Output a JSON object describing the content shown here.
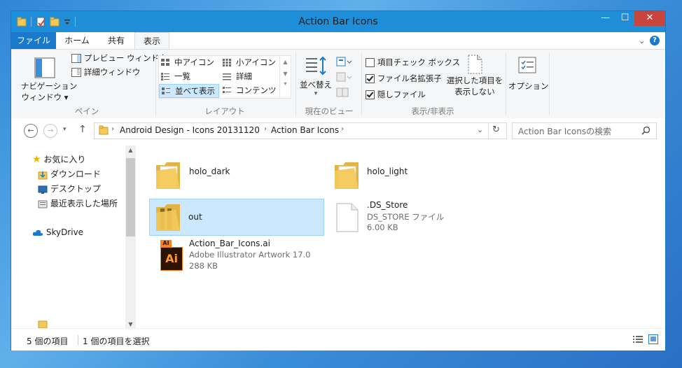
{
  "window": {
    "title": "Action Bar Icons",
    "minimize": "—",
    "maximize": "☐",
    "close": "✕"
  },
  "tabs": {
    "file": "ファイル",
    "home": "ホーム",
    "share": "共有",
    "view": "表示"
  },
  "ribbon": {
    "panes": {
      "nav_pane_line1": "ナビゲーション",
      "nav_pane_line2": "ウィンドウ",
      "preview_pane": "プレビュー ウィンドウ",
      "details_pane": "詳細ウィンドウ",
      "group_label": "ペイン"
    },
    "layout": {
      "medium_icons": "中アイコン",
      "small_icons": "小アイコン",
      "list": "一覧",
      "details": "詳細",
      "tiles": "並べて表示",
      "content": "コンテンツ",
      "group_label": "レイアウト"
    },
    "current_view": {
      "sort_by": "並べ替え",
      "group_label": "現在のビュー"
    },
    "show_hide": {
      "item_check_boxes": "項目チェック ボックス",
      "file_extensions": "ファイル名拡張子",
      "hidden_items": "隠しファイル",
      "item_check_boxes_checked": false,
      "file_extensions_checked": true,
      "hidden_items_checked": true,
      "hide_selected_line1": "選択した項目を",
      "hide_selected_line2": "表示しない",
      "group_label": "表示/非表示"
    },
    "options": "オプション"
  },
  "address": {
    "crumbs": [
      "Android Design - Icons 20131120",
      "Action Bar Icons"
    ],
    "search_placeholder": "Action Bar Iconsの検索"
  },
  "navpane": {
    "favorites": "お気に入り",
    "downloads": "ダウンロード",
    "desktop": "デスクトップ",
    "recent": "最近表示した場所",
    "skydrive": "SkyDrive"
  },
  "files": [
    {
      "name": "holo_dark",
      "type": "folder"
    },
    {
      "name": "holo_light",
      "type": "folder"
    },
    {
      "name": "out",
      "type": "folder",
      "selected": true
    },
    {
      "name": ".DS_Store",
      "type": "DS_STORE ファイル",
      "size": "6.00 KB"
    },
    {
      "name": "Action_Bar_Icons.ai",
      "type": "Adobe Illustrator Artwork 17.0",
      "size": "288 KB",
      "icon_text": "Ai",
      "icon_tab": "AI"
    }
  ],
  "status": {
    "count": "5 個の項目",
    "selected": "1 個の項目を選択"
  },
  "colors": {
    "accent": "#1979ca",
    "selection_bg": "#cce8ff",
    "selection_border": "#99d1ff",
    "folder": "#f3c95a"
  }
}
